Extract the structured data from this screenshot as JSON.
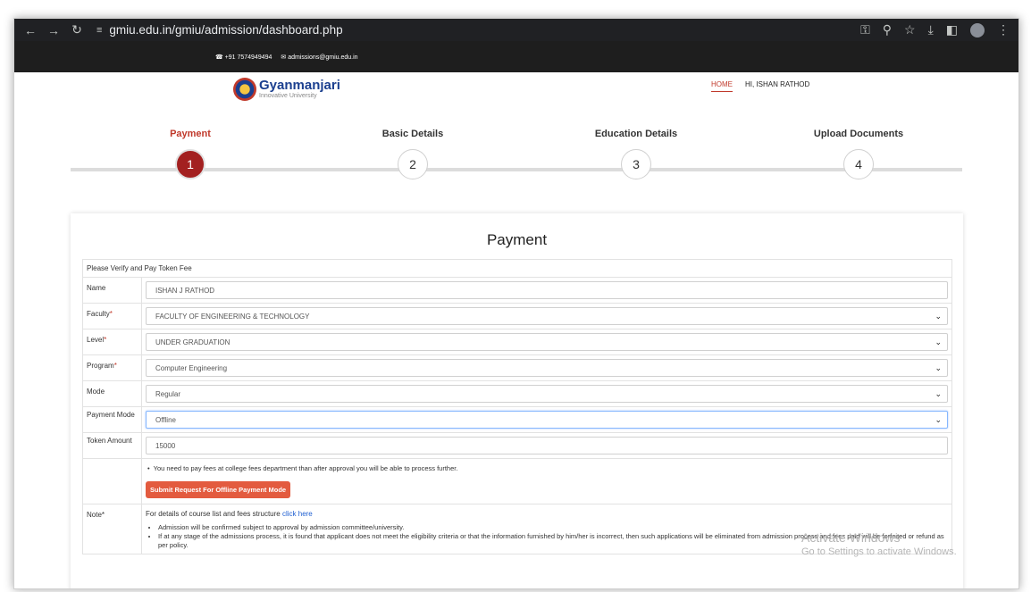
{
  "browser": {
    "url": "gmiu.edu.in/gmiu/admission/dashboard.php"
  },
  "topbar": {
    "phone": "☎ +91 7574949494",
    "email": "✉ admissions@gmiu.edu.in"
  },
  "logo": {
    "name": "Gyanmanjari",
    "tagline": "Innovative University"
  },
  "menu": {
    "home": "HOME",
    "user": "HI, ISHAN RATHOD"
  },
  "steps": [
    {
      "label": "Payment",
      "number": "1",
      "active": true
    },
    {
      "label": "Basic Details",
      "number": "2",
      "active": false
    },
    {
      "label": "Education Details",
      "number": "3",
      "active": false
    },
    {
      "label": "Upload Documents",
      "number": "4",
      "active": false
    }
  ],
  "card": {
    "title": "Payment",
    "intro": "Please Verify and Pay Token Fee",
    "fields": {
      "name_label": "Name",
      "name_value": "ISHAN J RATHOD",
      "faculty_label": "Faculty",
      "faculty_value": "FACULTY OF ENGINEERING & TECHNOLOGY",
      "level_label": "Level",
      "level_value": "UNDER GRADUATION",
      "program_label": "Program",
      "program_value": "Computer Engineering",
      "mode_label": "Mode",
      "mode_value": "Regular",
      "payment_mode_label": "Payment Mode",
      "payment_mode_value": "Offline",
      "token_label": "Token Amount",
      "token_value": "15000"
    },
    "required_mark": "*",
    "offline_notice": "You need to pay fees at college fees department than after approval you will be able to process further.",
    "offline_button": "Submit Request For Offline Payment Mode",
    "note_label": "Note*",
    "note_head": "For details of course list and fees structure ",
    "note_link": "click here",
    "note_items": [
      "Admission will be confirmed subject to approval by admission committee/university.",
      "If at any stage of the admissions process, it is found that applicant does not meet the eligibility criteria or that the information furnished by him/her is incorrect, then such applications will be eliminated from admission process and fees paid will be forfeited or refund as per policy."
    ]
  },
  "watermark": {
    "line1": "Activate Windows",
    "line2": "Go to Settings to activate Windows."
  }
}
